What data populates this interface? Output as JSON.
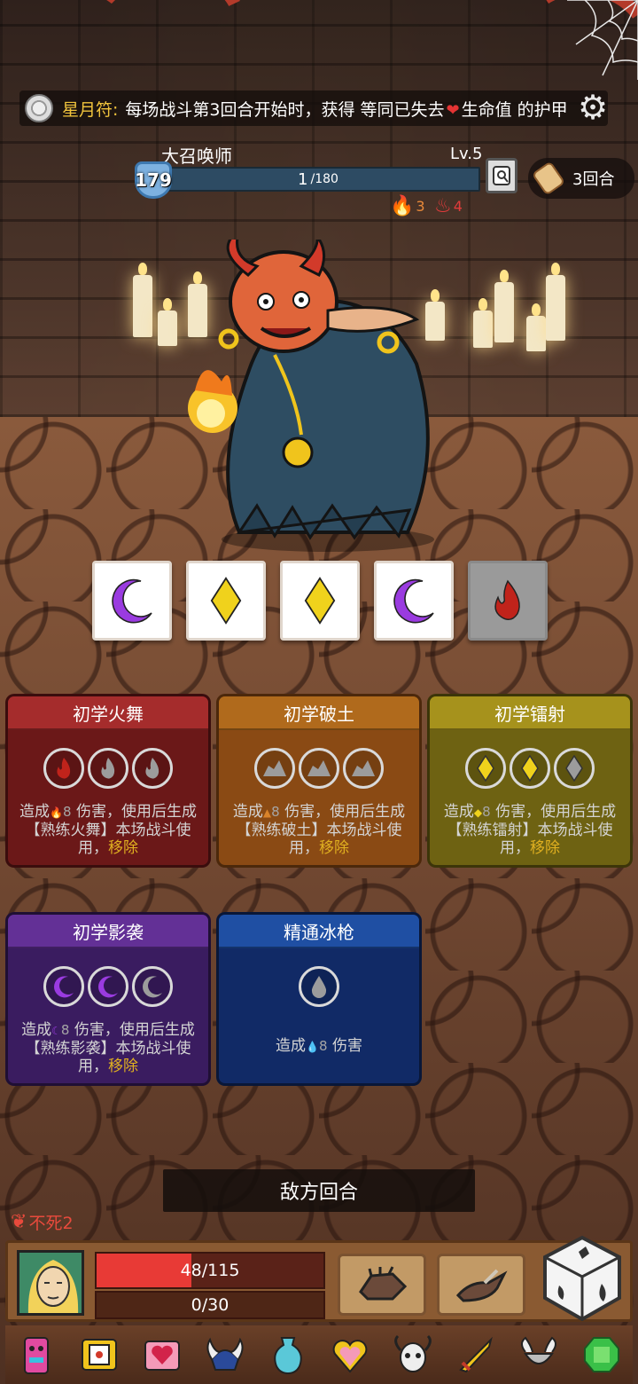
{
  "relic_bar": {
    "name": "星月符:",
    "desc_before": "每场战斗第3回合开始时，获得 等同已失去",
    "desc_after": "生命值 的护甲",
    "heart_icon": "heart-icon"
  },
  "enemy": {
    "name": "大召唤师",
    "level": "Lv.5",
    "shield": "179",
    "hp_current": "1",
    "hp_max": "/180",
    "hp_fraction": 0.0056,
    "buffs": [
      {
        "icon": "flame-stack-icon",
        "value": "3",
        "color": "#e8893a"
      },
      {
        "icon": "demon-fire-icon",
        "value": "4",
        "color": "#e23b3b"
      }
    ]
  },
  "round": {
    "label": "3回合"
  },
  "dice": [
    {
      "type": "moon",
      "used": false
    },
    {
      "type": "diamond",
      "used": false
    },
    {
      "type": "diamond",
      "used": false
    },
    {
      "type": "moon",
      "used": false
    },
    {
      "type": "fire",
      "used": true
    }
  ],
  "cards": [
    {
      "title": "初学火舞",
      "desc_a": "造成",
      "num": "8",
      "desc_b": " 伤害，使用后生成【熟练火舞】本场战斗使用，",
      "move": "移除"
    },
    {
      "title": "初学破土",
      "desc_a": "造成",
      "num": "8",
      "desc_b": " 伤害，使用后生成【熟练破土】本场战斗使用，",
      "move": "移除"
    },
    {
      "title": "初学镭射",
      "desc_a": "造成",
      "num": "8",
      "desc_b": " 伤害，使用后生成【熟练镭射】本场战斗使用，",
      "move": "移除"
    },
    {
      "title": "初学影袭",
      "desc_a": "造成",
      "num": "8",
      "desc_b": " 伤害，使用后生成【熟练影袭】本场战斗使用，",
      "move": "移除"
    },
    {
      "title": "精通冰枪",
      "desc_a": "造成",
      "num": "8",
      "desc_b": " 伤害"
    }
  ],
  "turn_banner": "敌方回合",
  "undying": "不死2",
  "player": {
    "hp": "48/115",
    "hp_fraction": 0.417,
    "shield": "0/30"
  },
  "colors": {
    "fire": "#c0231b",
    "moon": "#9a3be0",
    "diamond": "#f0d21c",
    "ice": "#2a63c8"
  }
}
